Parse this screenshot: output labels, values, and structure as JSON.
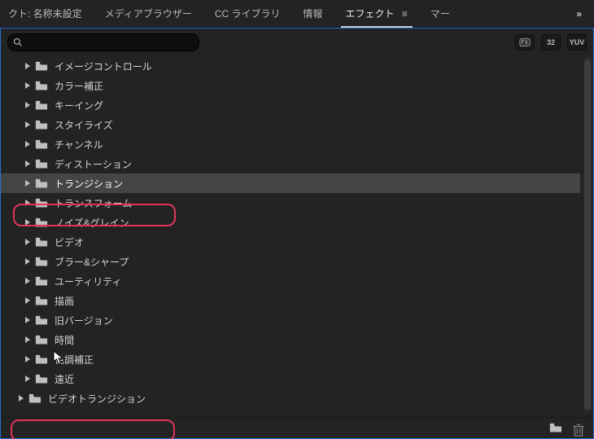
{
  "tabs": {
    "project": "クト: 名称未設定",
    "media": "メディアブラウザー",
    "cc": "CC ライブラリ",
    "info": "情報",
    "effects": "エフェクト",
    "marker": "マー"
  },
  "search": {
    "value": "",
    "placeholder": ""
  },
  "filters": {
    "fx_label": "",
    "thirtytwo": "32",
    "yuv": "YUV"
  },
  "tree": [
    {
      "label": "イメージコントロール",
      "depth": 1
    },
    {
      "label": "カラー補正",
      "depth": 1
    },
    {
      "label": "キーイング",
      "depth": 1
    },
    {
      "label": "スタイライズ",
      "depth": 1
    },
    {
      "label": "チャンネル",
      "depth": 1
    },
    {
      "label": "ディストーション",
      "depth": 1
    },
    {
      "label": "トランジション",
      "depth": 1,
      "selected": true,
      "highlight": true
    },
    {
      "label": "トランスフォーム",
      "depth": 1
    },
    {
      "label": "ノイズ&グレイン",
      "depth": 1
    },
    {
      "label": "ビデオ",
      "depth": 1
    },
    {
      "label": "ブラー&シャープ",
      "depth": 1
    },
    {
      "label": "ユーティリティ",
      "depth": 1
    },
    {
      "label": "描画",
      "depth": 1
    },
    {
      "label": "旧バージョン",
      "depth": 1
    },
    {
      "label": "時間",
      "depth": 1
    },
    {
      "label": "色調補正",
      "depth": 1
    },
    {
      "label": "遠近",
      "depth": 1
    },
    {
      "label": "ビデオトランジション",
      "depth": 0,
      "highlight": true
    }
  ],
  "overflow": "»"
}
